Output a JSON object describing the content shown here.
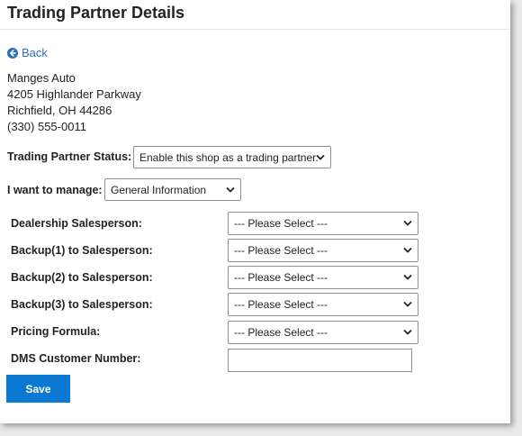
{
  "page": {
    "title": "Trading Partner Details"
  },
  "back": {
    "label": "Back",
    "icon": "arrow-left-circle-icon"
  },
  "address": {
    "name": "Manges Auto",
    "street": "4205 Highlander Parkway",
    "city_state_zip": "Richfield, OH 44286",
    "phone": "(330) 555-0011"
  },
  "status": {
    "label": "Trading Partner Status:",
    "value": "Enable this shop as a trading partner."
  },
  "manage": {
    "label": "I want to manage:",
    "value": "General Information"
  },
  "fields": {
    "dealership_salesperson": {
      "label": "Dealership Salesperson:",
      "value": "--- Please Select ---"
    },
    "backup1": {
      "label": "Backup(1) to Salesperson:",
      "value": "--- Please Select ---"
    },
    "backup2": {
      "label": "Backup(2) to Salesperson:",
      "value": "--- Please Select ---"
    },
    "backup3": {
      "label": "Backup(3) to Salesperson:",
      "value": "--- Please Select ---"
    },
    "pricing_formula": {
      "label": "Pricing Formula:",
      "value": "--- Please Select ---"
    },
    "dms_customer_number": {
      "label": "DMS Customer Number:",
      "value": ""
    }
  },
  "actions": {
    "save_label": "Save"
  },
  "colors": {
    "link": "#2f6fbf",
    "primary_button": "#0b78d1"
  }
}
